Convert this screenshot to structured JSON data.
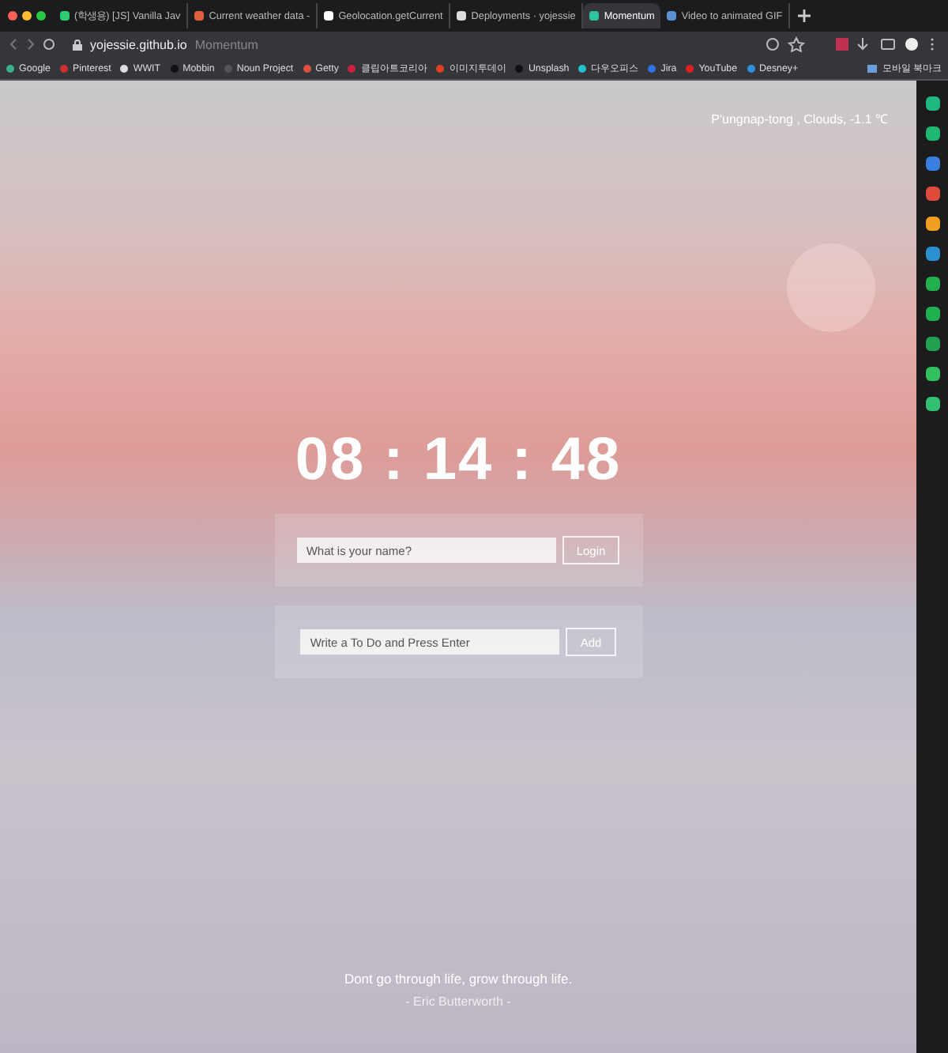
{
  "tabs": [
    {
      "title": "(학생용) [JS] Vanilla Jav",
      "selected": false,
      "color": "#2ecc71"
    },
    {
      "title": "Current weather data -",
      "selected": false,
      "color": "#e06040"
    },
    {
      "title": "Geolocation.getCurrent",
      "selected": false,
      "color": "#ffffff"
    },
    {
      "title": "Deployments · yojessie",
      "selected": false,
      "color": "#dddddd"
    },
    {
      "title": "Momentum",
      "selected": true,
      "color": "#2ec4a0"
    },
    {
      "title": "Video to animated GIF",
      "selected": false,
      "color": "#5a8fd0"
    }
  ],
  "address": {
    "url": "yojessie.github.io",
    "page_title": "Momentum"
  },
  "bookmarks": [
    {
      "label": "Google",
      "color": "#3cb08a"
    },
    {
      "label": "Pinterest",
      "color": "#d03030"
    },
    {
      "label": "WWIT",
      "color": "#dddddd"
    },
    {
      "label": "Mobbin",
      "color": "#111111"
    },
    {
      "label": "Noun Project",
      "color": "#555555"
    },
    {
      "label": "Getty",
      "color": "#e05040"
    },
    {
      "label": "클립아트코리아",
      "color": "#d02040"
    },
    {
      "label": "이미지투데이",
      "color": "#e04020"
    },
    {
      "label": "Unsplash",
      "color": "#111111"
    },
    {
      "label": "다우오피스",
      "color": "#20c0d0"
    },
    {
      "label": "Jira",
      "color": "#3070e0"
    },
    {
      "label": "YouTube",
      "color": "#e02020"
    },
    {
      "label": "Desney+",
      "color": "#3090e0"
    }
  ],
  "other_bookmarks": "모바일 북마크",
  "weather": "P'ungnap-tong , Clouds, -1.1 ℃",
  "clock": "08 : 14 : 48",
  "login": {
    "placeholder": "What is your name?",
    "button": "Login"
  },
  "todo": {
    "placeholder": "Write a To Do and Press Enter",
    "button": "Add"
  },
  "quote": {
    "text": "Dont go through life, grow through life.",
    "author": "- Eric Butterworth -"
  },
  "sidebar": [
    {
      "color": "#1fb880"
    },
    {
      "color": "#1fb870"
    },
    {
      "color": "#3a7ee0"
    },
    {
      "color": "#e04a3a"
    },
    {
      "color": "#f0a020"
    },
    {
      "color": "#2a90d0"
    },
    {
      "color": "#20b050"
    },
    {
      "color": "#20b050"
    },
    {
      "color": "#20a050"
    },
    {
      "color": "#30c060"
    },
    {
      "color": "#30c070"
    }
  ]
}
